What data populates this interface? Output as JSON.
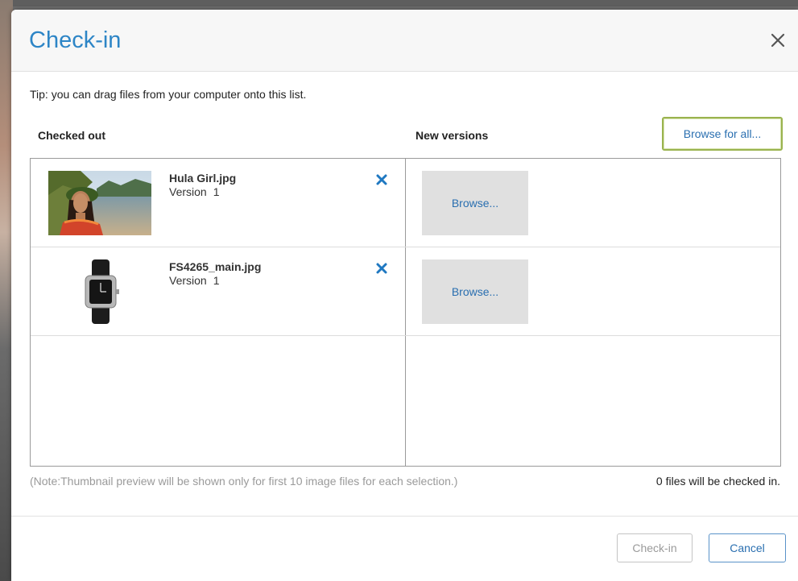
{
  "dialog": {
    "title": "Check-in",
    "close_icon": "close-icon",
    "tip": "Tip: you can drag files from your computer onto this list.",
    "columns": {
      "checked_out": "Checked out",
      "new_versions": "New versions"
    },
    "browse_all_label": "Browse for all...",
    "rows": [
      {
        "file_name": "Hula Girl.jpg",
        "version_label": "Version",
        "version_number": "1",
        "thumbnail": "hula-girl-photo",
        "remove_icon": "remove-x-icon",
        "browse_label": "Browse..."
      },
      {
        "file_name": "FS4265_main.jpg",
        "version_label": "Version",
        "version_number": "1",
        "thumbnail": "wristwatch-photo",
        "remove_icon": "remove-x-icon",
        "browse_label": "Browse..."
      }
    ],
    "note": "(Note:Thumbnail preview will be shown only for first 10 image files for each selection.)",
    "count_text": "0 files will be checked in.",
    "buttons": {
      "checkin": "Check-in",
      "cancel": "Cancel"
    }
  },
  "colors": {
    "accent": "#2d85c6",
    "link": "#2a6fb0",
    "focus_border": "#9ab34f",
    "browse_cell_bg": "#e0e0e0",
    "disabled_text": "#9a9a9a"
  }
}
